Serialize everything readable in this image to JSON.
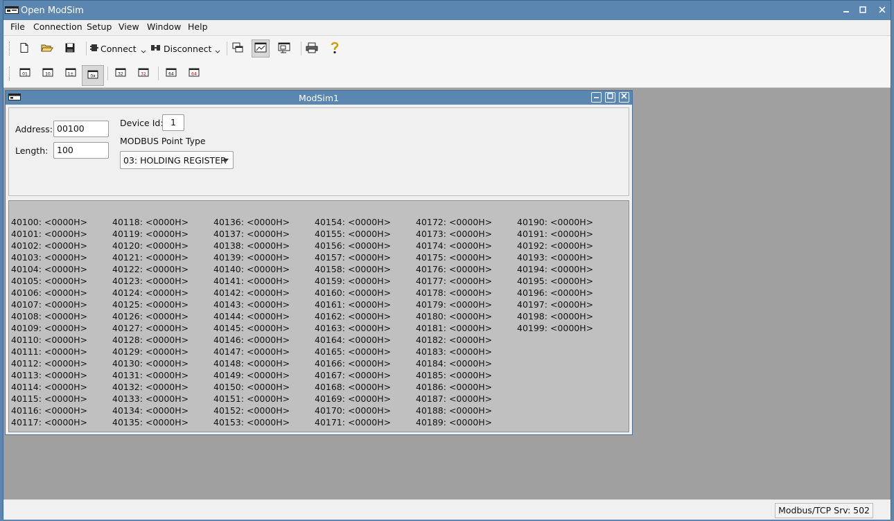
{
  "app": {
    "title": "Open ModSim"
  },
  "menu": [
    "File",
    "Connection",
    "Setup",
    "View",
    "Window",
    "Help"
  ],
  "toolbar": {
    "connect_label": "Connect",
    "disconnect_label": "Disconnect"
  },
  "child": {
    "title": "ModSim1",
    "address_label": "Address:",
    "address_value": "00100",
    "length_label": "Length:",
    "length_value": "100",
    "device_id_label": "Device Id:",
    "device_id_value": "1",
    "point_type_label": "MODBUS Point Type",
    "point_type_value": "03: HOLDING REGISTER"
  },
  "registers": {
    "start": 40100,
    "count": 100,
    "per_column": 18,
    "value_text": "<0000H>"
  },
  "status": {
    "text": "Modbus/TCP Srv: 502"
  }
}
